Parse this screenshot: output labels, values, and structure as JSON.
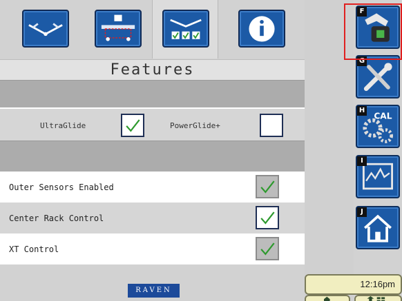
{
  "title": "Features",
  "tabs": [
    {
      "icon": "boom-sensors-icon"
    },
    {
      "icon": "center-rack-icon"
    },
    {
      "icon": "features-checklist-icon",
      "active": true
    },
    {
      "icon": "info-icon"
    }
  ],
  "modes": {
    "ultraglide_label": "UltraGlide",
    "ultraglide_checked": true,
    "powerglide_label": "PowerGlide+",
    "powerglide_checked": false
  },
  "features": [
    {
      "label": "Outer Sensors Enabled",
      "checked": true,
      "enabled": false
    },
    {
      "label": "Center Rack Control",
      "checked": true,
      "enabled": true
    },
    {
      "label": "XT Control",
      "checked": true,
      "enabled": false
    }
  ],
  "brand": "RAVEN",
  "side_menu": [
    {
      "letter": "F",
      "icon": "machine-icon"
    },
    {
      "letter": "G",
      "icon": "tools-icon"
    },
    {
      "letter": "H",
      "icon": "calibration-icon"
    },
    {
      "letter": "I",
      "icon": "diagnostics-icon"
    },
    {
      "letter": "J",
      "icon": "home-icon"
    }
  ],
  "clock": "12:16pm",
  "colors": {
    "accent": "#1c5aa6",
    "check": "#2e9a2e",
    "highlight": "#e02020"
  }
}
